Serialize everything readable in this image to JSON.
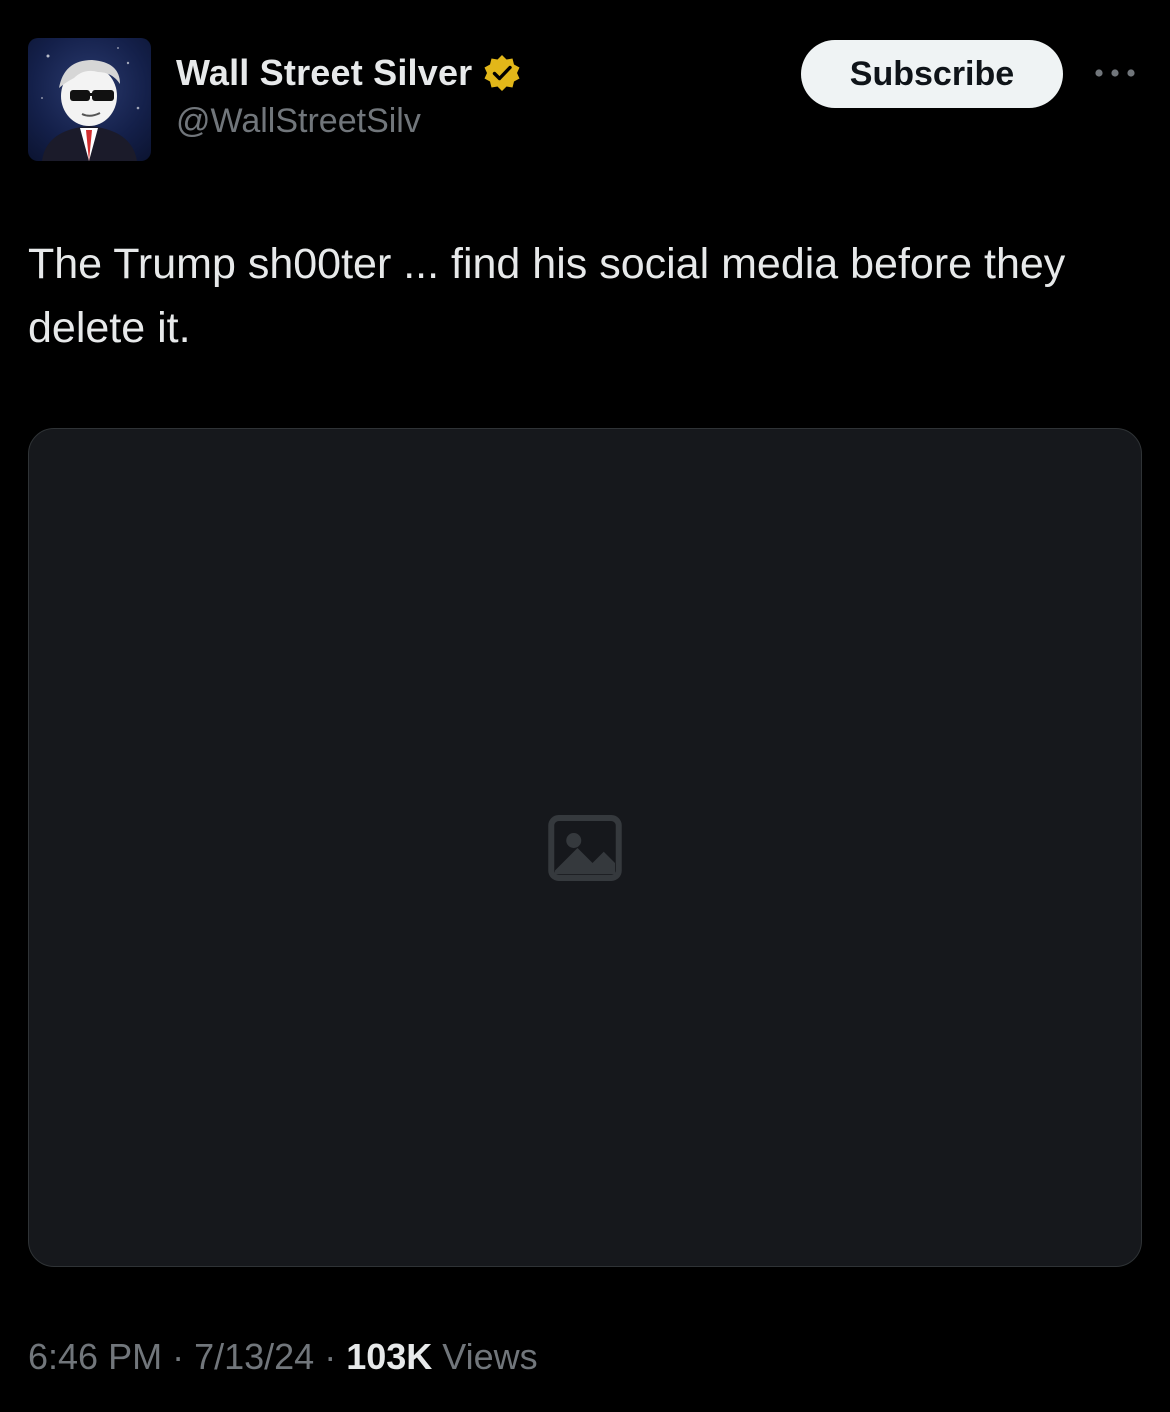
{
  "author": {
    "display_name": "Wall Street Silver",
    "handle": "@WallStreetSilv",
    "verified_badge": "verified-badge-gold",
    "avatar": "avatar-icon"
  },
  "actions": {
    "subscribe_label": "Subscribe",
    "more_icon": "more-icon"
  },
  "tweet": {
    "text": "The Trump sh00ter ... find his social media before they delete it.",
    "media": {
      "kind": "photo",
      "placeholder_icon": "image-icon"
    }
  },
  "meta": {
    "time": "6:46 PM",
    "date": "7/13/24",
    "separator": "·",
    "views_count": "103K",
    "views_label": "Views"
  },
  "colors": {
    "background": "#000000",
    "primary_text": "#e7e9ea",
    "secondary_text": "#71767b",
    "badge_gold": "#e2b719",
    "button_bg": "#eff3f4"
  }
}
